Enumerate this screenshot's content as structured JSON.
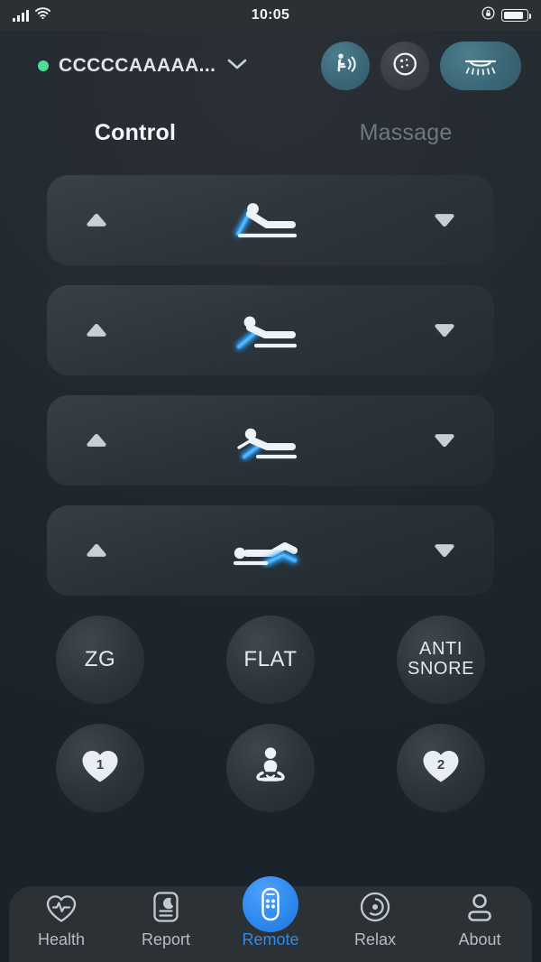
{
  "status_bar": {
    "time": "10:05",
    "signal_icon": "cellular-signal-icon",
    "wifi_icon": "wifi-icon",
    "lock_icon": "rotation-lock-icon",
    "battery_icon": "battery-icon"
  },
  "header": {
    "connection_state": "connected",
    "connection_dot_color": "#4ddc9a",
    "device_name": "CCCCCAAAAA...",
    "dropdown_icon": "chevron-down-icon",
    "buttons": [
      {
        "name": "massage-button",
        "icon": "seated-person-vibration-icon",
        "style": "teal"
      },
      {
        "name": "pillow-button",
        "icon": "pillow-icon",
        "style": "grey"
      },
      {
        "name": "underbed-light-button",
        "icon": "underbed-light-icon",
        "style": "teal-wide"
      }
    ]
  },
  "tabs": [
    {
      "label": "Control",
      "active": true
    },
    {
      "label": "Massage",
      "active": false
    }
  ],
  "controls": {
    "up_icon": "triangle-up-icon",
    "down_icon": "triangle-down-icon",
    "rows": [
      {
        "name": "head-control-row",
        "icon": "bed-head-raise-icon",
        "accent": "#2f9cf0"
      },
      {
        "name": "back-control-row",
        "icon": "bed-back-raise-icon",
        "accent": "#2f9cf0"
      },
      {
        "name": "lumbar-control-row",
        "icon": "bed-lumbar-raise-icon",
        "accent": "#2f9cf0"
      },
      {
        "name": "foot-control-row",
        "icon": "bed-foot-raise-icon",
        "accent": "#2f9cf0"
      }
    ]
  },
  "presets": {
    "row1": [
      {
        "name": "zero-g-button",
        "label": "ZG",
        "type": "text"
      },
      {
        "name": "flat-button",
        "label": "FLAT",
        "type": "text"
      },
      {
        "name": "anti-snore-button",
        "label": "ANTI\nSNORE",
        "label_line1": "ANTI",
        "label_line2": "SNORE",
        "type": "text-two-line"
      }
    ],
    "row2": [
      {
        "name": "memory-1-button",
        "icon": "heart-one-icon",
        "label": "1"
      },
      {
        "name": "meditation-button",
        "icon": "meditation-person-icon",
        "label": ""
      },
      {
        "name": "memory-2-button",
        "icon": "heart-two-icon",
        "label": "2"
      }
    ]
  },
  "bottom_nav": {
    "active_color": "#2f8aee",
    "items": [
      {
        "label": "Health",
        "icon": "heart-pulse-icon",
        "active": false
      },
      {
        "label": "Report",
        "icon": "report-moon-icon",
        "active": false
      },
      {
        "label": "Remote",
        "icon": "remote-control-icon",
        "active": true
      },
      {
        "label": "Relax",
        "icon": "relax-waves-icon",
        "active": false
      },
      {
        "label": "About",
        "icon": "person-icon",
        "active": false
      }
    ]
  }
}
